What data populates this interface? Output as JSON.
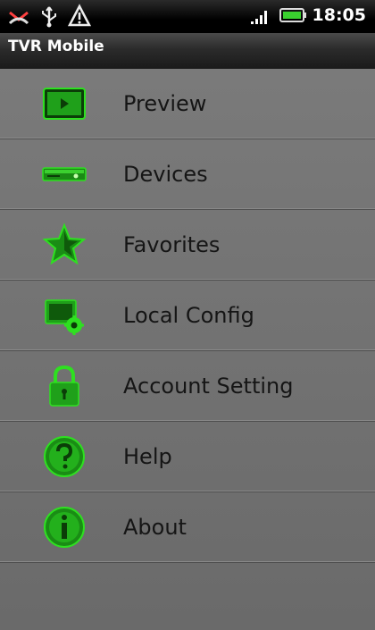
{
  "status_bar": {
    "time": "18:05",
    "icons_left": [
      "missed-call-icon",
      "usb-icon",
      "warning-icon"
    ],
    "icons_right": [
      "signal-icon",
      "battery-icon"
    ]
  },
  "app": {
    "title": "TVR Mobile"
  },
  "menu": {
    "items": [
      {
        "label": "Preview",
        "icon": "preview-icon"
      },
      {
        "label": "Devices",
        "icon": "devices-icon"
      },
      {
        "label": "Favorites",
        "icon": "star-icon"
      },
      {
        "label": "Local Config",
        "icon": "local-config-icon"
      },
      {
        "label": "Account Setting",
        "icon": "lock-icon"
      },
      {
        "label": "Help",
        "icon": "help-icon"
      },
      {
        "label": "About",
        "icon": "info-icon"
      }
    ]
  },
  "colors": {
    "accent_green": "#22c41a",
    "dark_green": "#0b3d08",
    "menu_background": "#6a6a6a"
  }
}
